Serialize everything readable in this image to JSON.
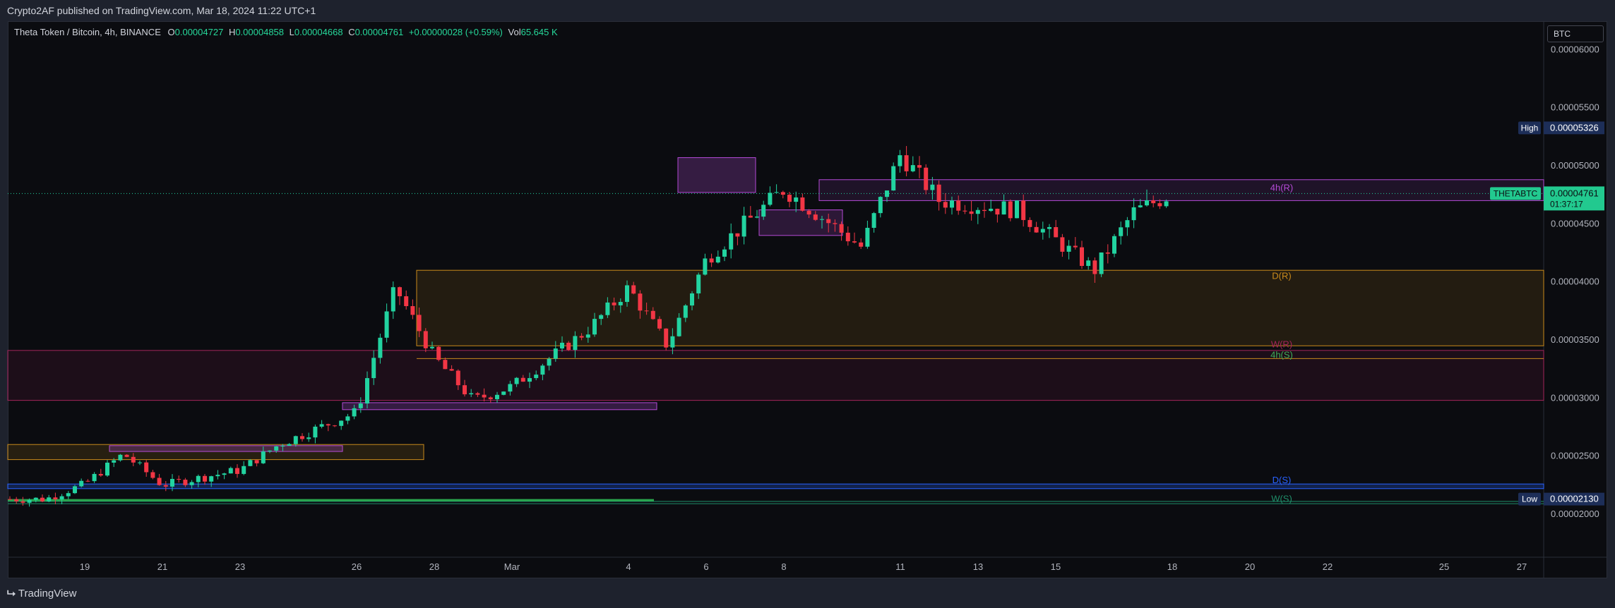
{
  "header": {
    "published": "Crypto2AF published on TradingView.com, Mar 18, 2024 11:22 UTC+1"
  },
  "legend": {
    "symbol": "Theta Token / Bitcoin, 4h, BINANCE",
    "open_label": "O",
    "open": "0.00004727",
    "high_label": "H",
    "high": "0.00004858",
    "low_label": "L",
    "low": "0.00004668",
    "close_label": "C",
    "close": "0.00004761",
    "change": "+0.00000028 (+0.59%)",
    "vol_label": "Vol",
    "vol": "65.645 K"
  },
  "currency_button": "BTC",
  "price_axis": {
    "ticks": [
      "0.00006000",
      "0.00005500",
      "0.00005000",
      "0.00004500",
      "0.00004000",
      "0.00003500",
      "0.00003000",
      "0.00002500",
      "0.00002000"
    ],
    "high_label": "High",
    "high_value": "0.00005326",
    "low_label": "Low",
    "low_value": "0.00002130",
    "current_symbol": "THETABTC",
    "current_price": "0.00004761",
    "countdown": "01:37:17"
  },
  "time_axis": {
    "labels": [
      "19",
      "21",
      "23",
      "26",
      "28",
      "Mar",
      "4",
      "6",
      "8",
      "11",
      "13",
      "15",
      "18",
      "20",
      "22",
      "25",
      "27"
    ]
  },
  "zone_labels": {
    "h4_r": "4h(R)",
    "d_r": "D(R)",
    "w_r": "W(R)",
    "h4_s": "4h(S)",
    "d_s": "D(S)",
    "w_s": "W(S)"
  },
  "footer": {
    "brand": "TradingView"
  },
  "colors": {
    "up": "#22d3a0",
    "down": "#f23645",
    "h4": "#b44ad6",
    "daily": "#c98a1c",
    "weekly": "#a3245a",
    "daily_support": "#2962ff",
    "weekly_support": "#1f8f6a"
  },
  "chart_data": {
    "type": "candlestick",
    "title": "Theta Token / Bitcoin, 4h, BINANCE",
    "xlabel": "",
    "ylabel": "",
    "ylim": [
      1.82e-05,
      6.41e-05
    ],
    "yticks": [
      2e-05,
      2.5e-05,
      3e-05,
      3.5e-05,
      4e-05,
      4.5e-05,
      5e-05,
      5.5e-05,
      6e-05
    ],
    "x_dates": [
      "Feb 19",
      "Feb 21",
      "Feb 23",
      "Feb 26",
      "Feb 28",
      "Mar 1",
      "Mar 4",
      "Mar 6",
      "Mar 8",
      "Mar 11",
      "Mar 13",
      "Mar 15",
      "Mar 18",
      "Mar 20",
      "Mar 22",
      "Mar 25",
      "Mar 27"
    ],
    "series_approx": [
      {
        "date": "Feb 18",
        "value": 2.13e-05
      },
      {
        "date": "Feb 19",
        "value": 2.26e-05
      },
      {
        "date": "Feb 20",
        "value": 2.52e-05
      },
      {
        "date": "Feb 21",
        "value": 2.25e-05
      },
      {
        "date": "Feb 23",
        "value": 2.38e-05
      },
      {
        "date": "Feb 24",
        "value": 2.6e-05
      },
      {
        "date": "Feb 26",
        "value": 2.88e-05
      },
      {
        "date": "Feb 27",
        "value": 3.95e-05
      },
      {
        "date": "Feb 28",
        "value": 3.35e-05
      },
      {
        "date": "Feb 29",
        "value": 2.98e-05
      },
      {
        "date": "Mar 1",
        "value": 3.1e-05
      },
      {
        "date": "Mar 3",
        "value": 3.6e-05
      },
      {
        "date": "Mar 4",
        "value": 3.95e-05
      },
      {
        "date": "Mar 5",
        "value": 3.45e-05
      },
      {
        "date": "Mar 6",
        "value": 4.2e-05
      },
      {
        "date": "Mar 8",
        "value": 4.8e-05
      },
      {
        "date": "Mar 10",
        "value": 4.3e-05
      },
      {
        "date": "Mar 11",
        "value": 5.1e-05
      },
      {
        "date": "Mar 12",
        "value": 4.7e-05
      },
      {
        "date": "Mar 14",
        "value": 4.62e-05
      },
      {
        "date": "Mar 16",
        "value": 4.1e-05
      },
      {
        "date": "Mar 17",
        "value": 4.6e-05
      },
      {
        "date": "Mar 18",
        "value": 4.761e-05
      }
    ],
    "zones": [
      {
        "label": "4h(R)",
        "from": 4.7e-05,
        "to": 4.88e-05
      },
      {
        "label": "D(R)",
        "from": 3.45e-05,
        "to": 4.1e-05
      },
      {
        "label": "W(R)",
        "from": 2.98e-05,
        "to": 3.41e-05
      },
      {
        "label": "4h(S)",
        "from": 3.34e-05,
        "to": 3.34e-05
      },
      {
        "label": "D(S)",
        "from": 2.26e-05,
        "to": 2.28e-05
      },
      {
        "label": "W(S)",
        "from": 2.09e-05,
        "to": 2.11e-05
      }
    ],
    "last_price": 4.761e-05,
    "high": 5.326e-05,
    "low": 2.13e-05,
    "grid": false
  }
}
